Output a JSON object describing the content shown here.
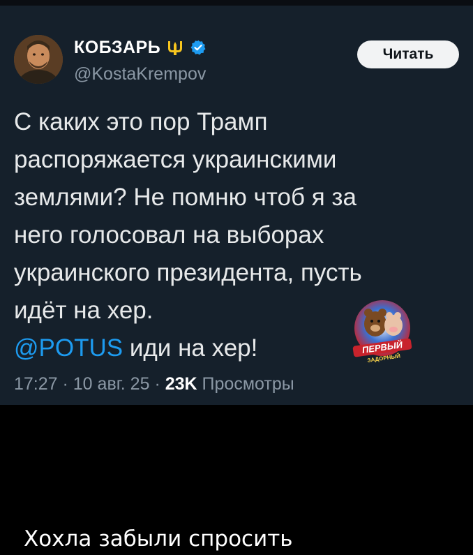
{
  "tweet": {
    "display_name": "КОБЗАРЬ",
    "handle": "@KostaKrempov",
    "follow_label": "Читать",
    "lines": [
      "С каких это пор Трамп",
      "распоряжается украинскими",
      "землями? Не помню чтоб я за",
      "него голосовал на выборах",
      "украинского президента, пусть",
      "идёт на хер."
    ],
    "mention": "@POTUS",
    "mention_suffix": " иди на хер!",
    "time": "17:27",
    "date": "10 авг. 25",
    "separator": " · ",
    "views_count": "23K",
    "views_label": "Просмотры"
  },
  "watermark": {
    "line1": "ПЕРВЫЙ",
    "line2": "ЗАДОРНЫЙ"
  },
  "caption": "Хохла забыли спросить",
  "colors": {
    "background": "#15202b",
    "accent": "#1d9bf0",
    "text": "#e7e9ea",
    "muted": "#8b98a5",
    "trident": "#f7c51e"
  },
  "icons": {
    "trident": "trident-icon",
    "verified": "verified-badge-icon"
  }
}
